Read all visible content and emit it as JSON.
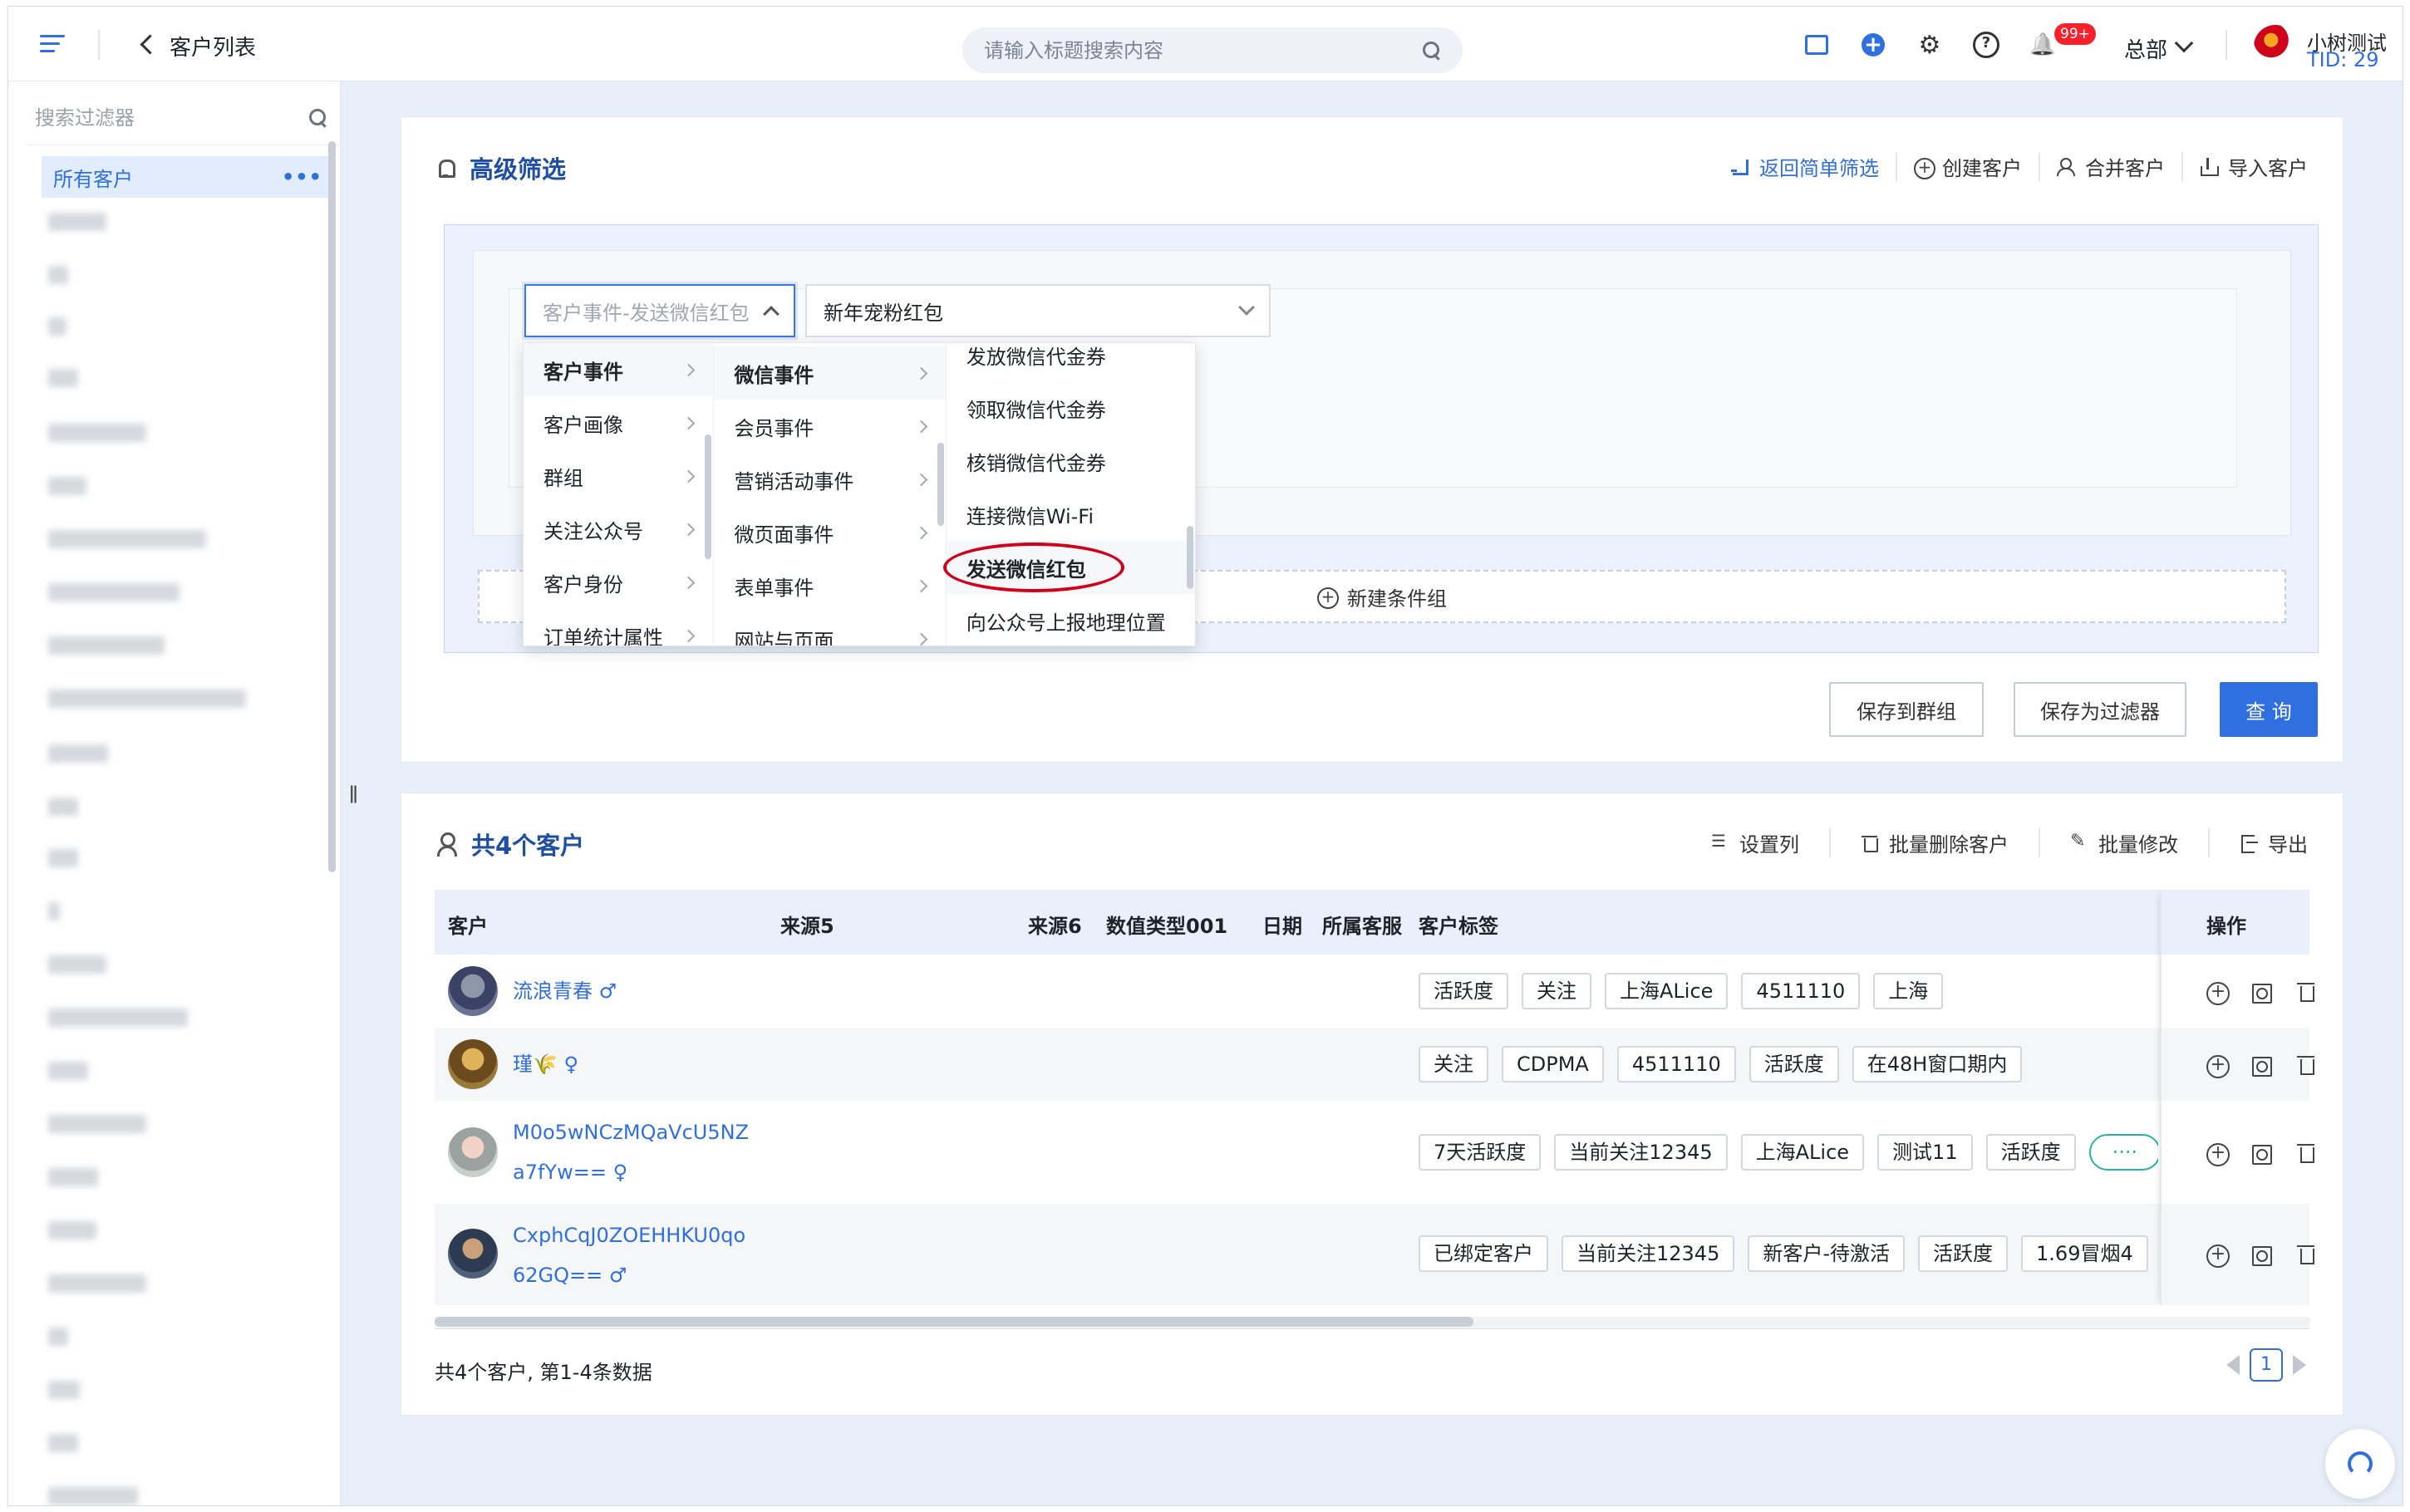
{
  "header": {
    "page_title": "客户列表",
    "search_placeholder": "请输入标题搜索内容",
    "badge_count": "99+",
    "org_label": "总部",
    "user_name": "小树测试",
    "user_tid": "TID: 29",
    "accent": "#2f6fe0"
  },
  "sidebar": {
    "search_placeholder": "搜索过滤器",
    "active_item": "所有客户",
    "active_more": "•••"
  },
  "filter": {
    "title": "高级筛选",
    "actions": {
      "simple": "返回简单筛选",
      "create": "创建客户",
      "merge": "合并客户",
      "import": "导入客户"
    },
    "select1_placeholder": "客户事件-发送微信红包",
    "select2_value": "新年宠粉红包",
    "new_group": "新建条件组",
    "cascader": {
      "col1": [
        "客户事件",
        "客户画像",
        "群组",
        "关注公众号",
        "客户身份",
        "订单统计属性"
      ],
      "col2": [
        "微信事件",
        "会员事件",
        "营销活动事件",
        "微页面事件",
        "表单事件",
        "网站与页面"
      ],
      "col3": [
        "发放微信代金券",
        "领取微信代金券",
        "核销微信代金券",
        "连接微信Wi-Fi",
        "发送微信红包",
        "向公众号上报地理位置"
      ]
    },
    "buttons": {
      "save_group": "保存到群组",
      "save_filter": "保存为过滤器",
      "query": "查 询"
    }
  },
  "list": {
    "title": "共4个客户",
    "actions": {
      "columns": "设置列",
      "batch_delete": "批量删除客户",
      "batch_edit": "批量修改",
      "export": "导出"
    },
    "columns": [
      "客户",
      "来源5",
      "来源6",
      "数值类型001",
      "日期",
      "所属客服",
      "客户标签",
      "操作"
    ],
    "rows": [
      {
        "name": "流浪青春 ♂",
        "name2": "",
        "tags": [
          "活跃度",
          "关注",
          "上海ALice",
          "4511110",
          "上海"
        ]
      },
      {
        "name": "瑾🌾 ♀",
        "name2": "",
        "tags": [
          "关注",
          "CDPMA",
          "4511110",
          "活跃度",
          "在48H窗口期内"
        ]
      },
      {
        "name": "M0o5wNCzMQaVcU5NZ",
        "name2": "a7fYw== ♀",
        "tags": [
          "7天活跃度",
          "当前关注12345",
          "上海ALice",
          "测试11",
          "活跃度"
        ],
        "more": "····"
      },
      {
        "name": "CxphCqJ0ZOEHHKU0qo",
        "name2": "62GQ== ♂",
        "tags": [
          "已绑定客户",
          "当前关注12345",
          "新客户-待激活",
          "活跃度",
          "1.69冒烟4"
        ]
      }
    ],
    "summary": "共4个客户, 第1-4条数据",
    "page": "1"
  }
}
